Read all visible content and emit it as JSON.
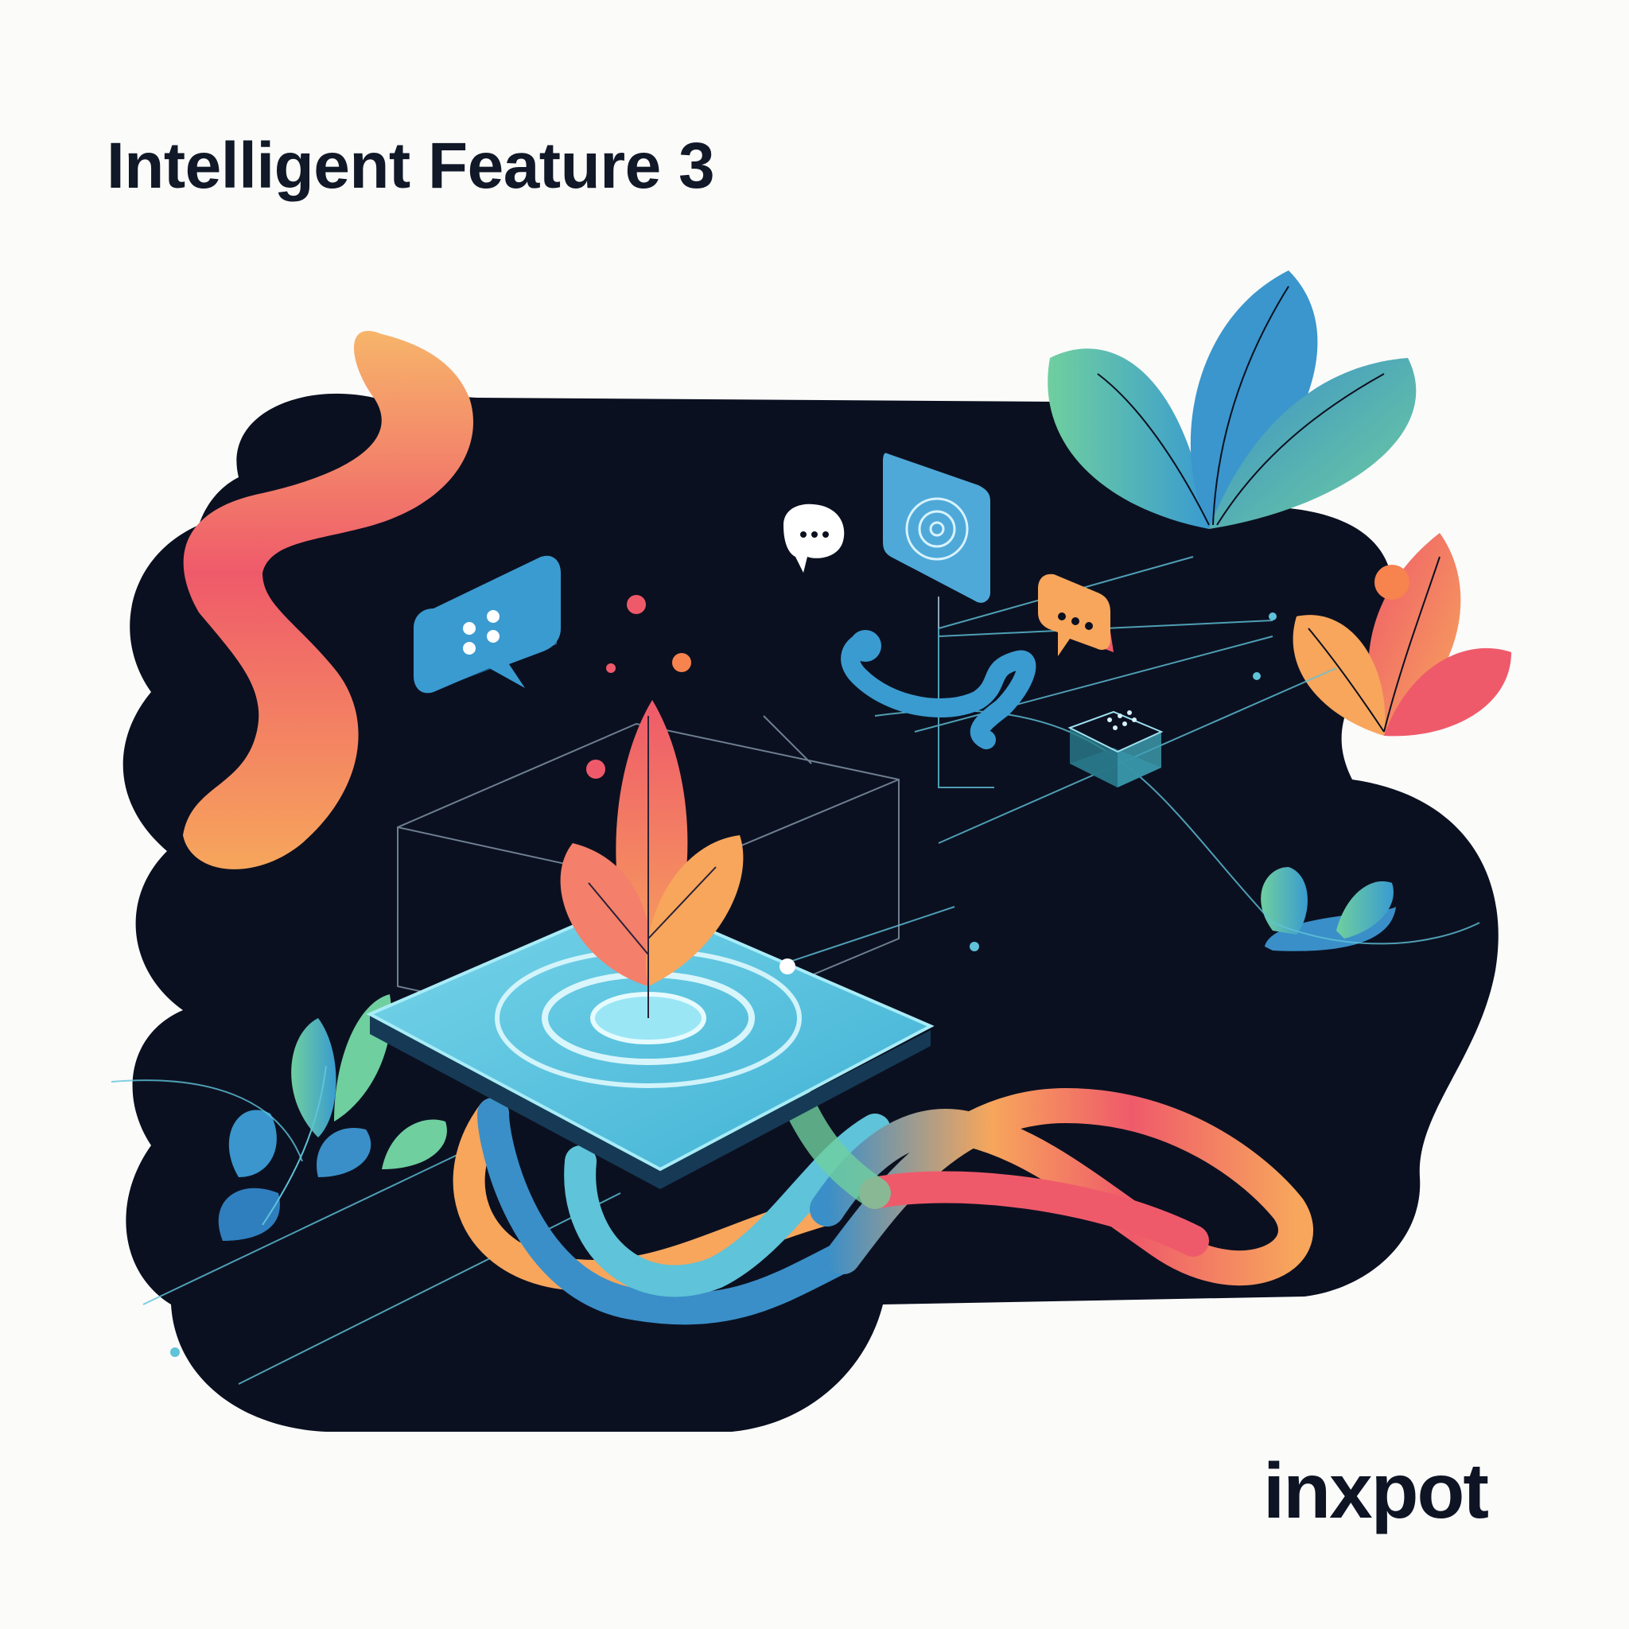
{
  "header": {
    "title": "Intelligent Feature 3"
  },
  "brand": {
    "logo_text": "inxpot"
  },
  "colors": {
    "background": "#fbfbfa",
    "blob": "#0b1020",
    "coral": "#ef5a6a",
    "orange": "#f7a65c",
    "teal": "#5fc3d9",
    "blue": "#3a8fc8",
    "green": "#6fcf9f",
    "text": "#111827"
  },
  "illustration": {
    "icons": [
      "chat-bubble-icon",
      "speech-bubble-icon",
      "target-card-icon",
      "message-bubble-icon",
      "mini-cube-icon",
      "hook-cable-icon"
    ],
    "elements": [
      "glowing-platform",
      "leaf-sprout",
      "wire-cube",
      "ribbon-loop",
      "leaf-plants",
      "circuit-lines"
    ]
  }
}
